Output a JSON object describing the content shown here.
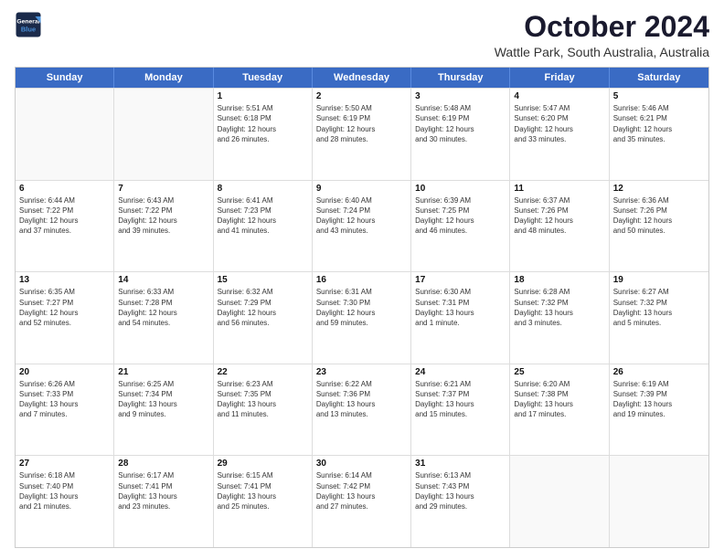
{
  "logo": {
    "line1": "General",
    "line2": "Blue"
  },
  "title": "October 2024",
  "location": "Wattle Park, South Australia, Australia",
  "header_days": [
    "Sunday",
    "Monday",
    "Tuesday",
    "Wednesday",
    "Thursday",
    "Friday",
    "Saturday"
  ],
  "weeks": [
    [
      {
        "day": "",
        "lines": [],
        "empty": true
      },
      {
        "day": "",
        "lines": [],
        "empty": true
      },
      {
        "day": "1",
        "lines": [
          "Sunrise: 5:51 AM",
          "Sunset: 6:18 PM",
          "Daylight: 12 hours",
          "and 26 minutes."
        ]
      },
      {
        "day": "2",
        "lines": [
          "Sunrise: 5:50 AM",
          "Sunset: 6:19 PM",
          "Daylight: 12 hours",
          "and 28 minutes."
        ]
      },
      {
        "day": "3",
        "lines": [
          "Sunrise: 5:48 AM",
          "Sunset: 6:19 PM",
          "Daylight: 12 hours",
          "and 30 minutes."
        ]
      },
      {
        "day": "4",
        "lines": [
          "Sunrise: 5:47 AM",
          "Sunset: 6:20 PM",
          "Daylight: 12 hours",
          "and 33 minutes."
        ]
      },
      {
        "day": "5",
        "lines": [
          "Sunrise: 5:46 AM",
          "Sunset: 6:21 PM",
          "Daylight: 12 hours",
          "and 35 minutes."
        ]
      }
    ],
    [
      {
        "day": "6",
        "lines": [
          "Sunrise: 6:44 AM",
          "Sunset: 7:22 PM",
          "Daylight: 12 hours",
          "and 37 minutes."
        ]
      },
      {
        "day": "7",
        "lines": [
          "Sunrise: 6:43 AM",
          "Sunset: 7:22 PM",
          "Daylight: 12 hours",
          "and 39 minutes."
        ]
      },
      {
        "day": "8",
        "lines": [
          "Sunrise: 6:41 AM",
          "Sunset: 7:23 PM",
          "Daylight: 12 hours",
          "and 41 minutes."
        ]
      },
      {
        "day": "9",
        "lines": [
          "Sunrise: 6:40 AM",
          "Sunset: 7:24 PM",
          "Daylight: 12 hours",
          "and 43 minutes."
        ]
      },
      {
        "day": "10",
        "lines": [
          "Sunrise: 6:39 AM",
          "Sunset: 7:25 PM",
          "Daylight: 12 hours",
          "and 46 minutes."
        ]
      },
      {
        "day": "11",
        "lines": [
          "Sunrise: 6:37 AM",
          "Sunset: 7:26 PM",
          "Daylight: 12 hours",
          "and 48 minutes."
        ]
      },
      {
        "day": "12",
        "lines": [
          "Sunrise: 6:36 AM",
          "Sunset: 7:26 PM",
          "Daylight: 12 hours",
          "and 50 minutes."
        ]
      }
    ],
    [
      {
        "day": "13",
        "lines": [
          "Sunrise: 6:35 AM",
          "Sunset: 7:27 PM",
          "Daylight: 12 hours",
          "and 52 minutes."
        ]
      },
      {
        "day": "14",
        "lines": [
          "Sunrise: 6:33 AM",
          "Sunset: 7:28 PM",
          "Daylight: 12 hours",
          "and 54 minutes."
        ]
      },
      {
        "day": "15",
        "lines": [
          "Sunrise: 6:32 AM",
          "Sunset: 7:29 PM",
          "Daylight: 12 hours",
          "and 56 minutes."
        ]
      },
      {
        "day": "16",
        "lines": [
          "Sunrise: 6:31 AM",
          "Sunset: 7:30 PM",
          "Daylight: 12 hours",
          "and 59 minutes."
        ]
      },
      {
        "day": "17",
        "lines": [
          "Sunrise: 6:30 AM",
          "Sunset: 7:31 PM",
          "Daylight: 13 hours",
          "and 1 minute."
        ]
      },
      {
        "day": "18",
        "lines": [
          "Sunrise: 6:28 AM",
          "Sunset: 7:32 PM",
          "Daylight: 13 hours",
          "and 3 minutes."
        ]
      },
      {
        "day": "19",
        "lines": [
          "Sunrise: 6:27 AM",
          "Sunset: 7:32 PM",
          "Daylight: 13 hours",
          "and 5 minutes."
        ]
      }
    ],
    [
      {
        "day": "20",
        "lines": [
          "Sunrise: 6:26 AM",
          "Sunset: 7:33 PM",
          "Daylight: 13 hours",
          "and 7 minutes."
        ]
      },
      {
        "day": "21",
        "lines": [
          "Sunrise: 6:25 AM",
          "Sunset: 7:34 PM",
          "Daylight: 13 hours",
          "and 9 minutes."
        ]
      },
      {
        "day": "22",
        "lines": [
          "Sunrise: 6:23 AM",
          "Sunset: 7:35 PM",
          "Daylight: 13 hours",
          "and 11 minutes."
        ]
      },
      {
        "day": "23",
        "lines": [
          "Sunrise: 6:22 AM",
          "Sunset: 7:36 PM",
          "Daylight: 13 hours",
          "and 13 minutes."
        ]
      },
      {
        "day": "24",
        "lines": [
          "Sunrise: 6:21 AM",
          "Sunset: 7:37 PM",
          "Daylight: 13 hours",
          "and 15 minutes."
        ]
      },
      {
        "day": "25",
        "lines": [
          "Sunrise: 6:20 AM",
          "Sunset: 7:38 PM",
          "Daylight: 13 hours",
          "and 17 minutes."
        ]
      },
      {
        "day": "26",
        "lines": [
          "Sunrise: 6:19 AM",
          "Sunset: 7:39 PM",
          "Daylight: 13 hours",
          "and 19 minutes."
        ]
      }
    ],
    [
      {
        "day": "27",
        "lines": [
          "Sunrise: 6:18 AM",
          "Sunset: 7:40 PM",
          "Daylight: 13 hours",
          "and 21 minutes."
        ]
      },
      {
        "day": "28",
        "lines": [
          "Sunrise: 6:17 AM",
          "Sunset: 7:41 PM",
          "Daylight: 13 hours",
          "and 23 minutes."
        ]
      },
      {
        "day": "29",
        "lines": [
          "Sunrise: 6:15 AM",
          "Sunset: 7:41 PM",
          "Daylight: 13 hours",
          "and 25 minutes."
        ]
      },
      {
        "day": "30",
        "lines": [
          "Sunrise: 6:14 AM",
          "Sunset: 7:42 PM",
          "Daylight: 13 hours",
          "and 27 minutes."
        ]
      },
      {
        "day": "31",
        "lines": [
          "Sunrise: 6:13 AM",
          "Sunset: 7:43 PM",
          "Daylight: 13 hours",
          "and 29 minutes."
        ]
      },
      {
        "day": "",
        "lines": [],
        "empty": true
      },
      {
        "day": "",
        "lines": [],
        "empty": true
      }
    ]
  ]
}
